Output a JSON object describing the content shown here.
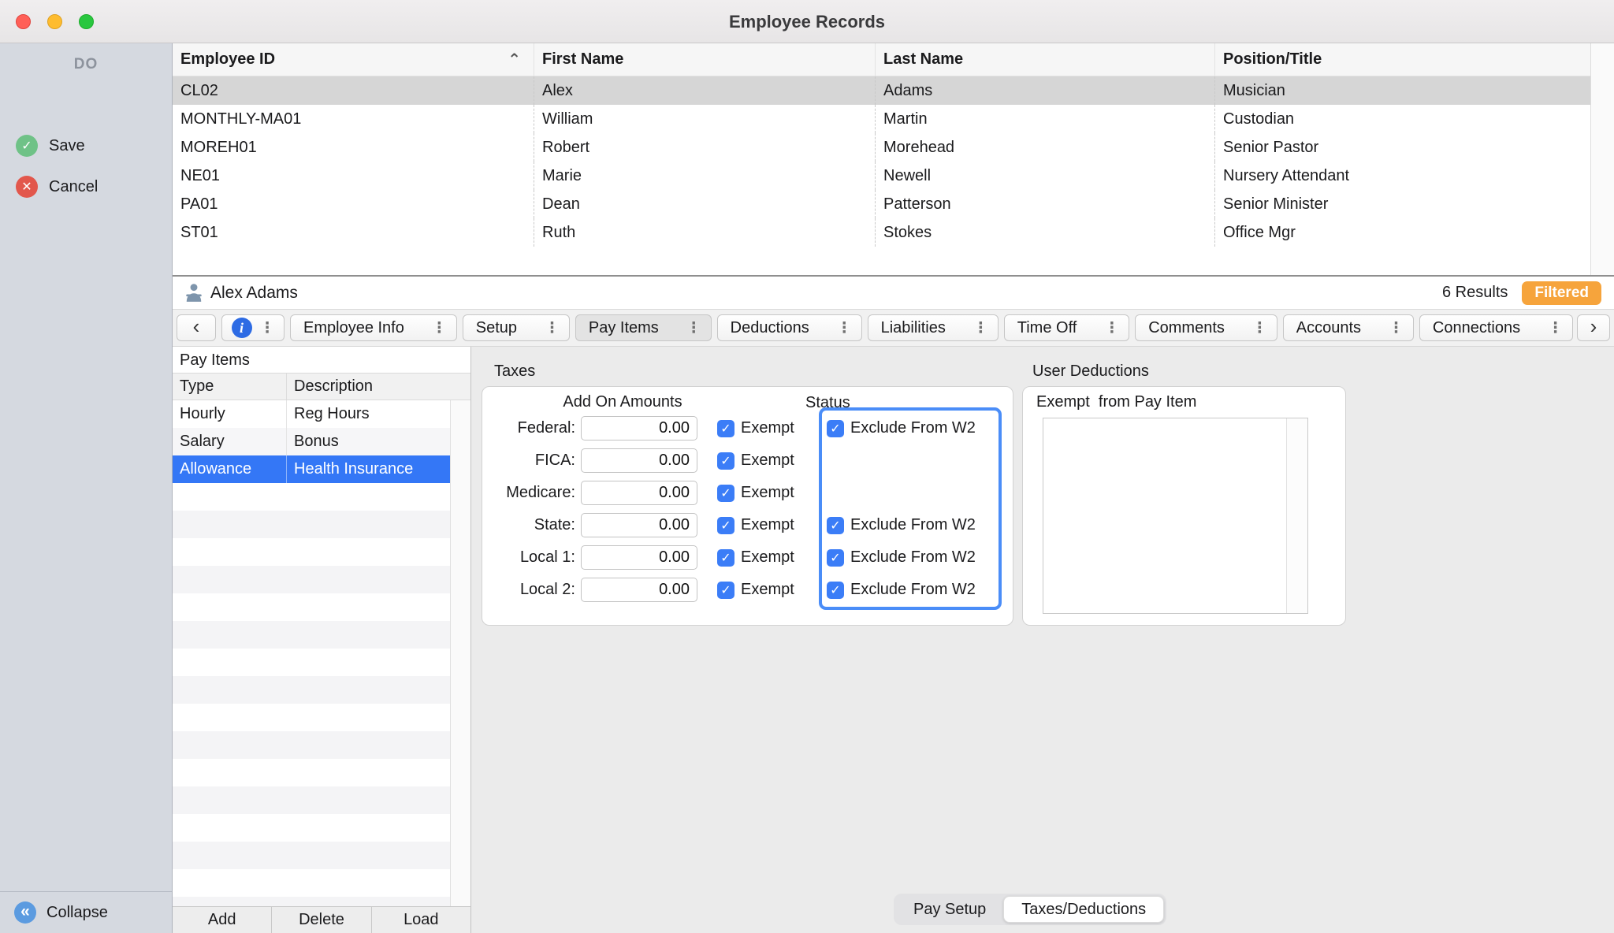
{
  "window": {
    "title": "Employee Records"
  },
  "sidebar": {
    "header": "DO",
    "save_label": "Save",
    "cancel_label": "Cancel",
    "collapse_label": "Collapse"
  },
  "employee_table": {
    "columns": [
      "Employee ID",
      "First Name",
      "Last Name",
      "Position/Title"
    ],
    "sort_column": "Employee ID",
    "sort_direction": "ascending",
    "rows": [
      {
        "id": "CL02",
        "first_name": "Alex",
        "last_name": "Adams",
        "position": "Musician",
        "selected": true
      },
      {
        "id": "MONTHLY-MA01",
        "first_name": "William",
        "last_name": "Martin",
        "position": "Custodian",
        "selected": false
      },
      {
        "id": "MOREH01",
        "first_name": "Robert",
        "last_name": "Morehead",
        "position": "Senior Pastor",
        "selected": false
      },
      {
        "id": "NE01",
        "first_name": "Marie",
        "last_name": "Newell",
        "position": "Nursery Attendant",
        "selected": false
      },
      {
        "id": "PA01",
        "first_name": "Dean",
        "last_name": "Patterson",
        "position": "Senior Minister",
        "selected": false
      },
      {
        "id": "ST01",
        "first_name": "Ruth",
        "last_name": "Stokes",
        "position": "Office Mgr",
        "selected": false
      }
    ]
  },
  "record_bar": {
    "record_name": "Alex Adams",
    "results_count": "6 Results",
    "filter_badge": "Filtered"
  },
  "tab_bar": {
    "tabs": [
      {
        "label": "Employee Info",
        "active": false
      },
      {
        "label": "Setup",
        "active": false
      },
      {
        "label": "Pay Items",
        "active": true
      },
      {
        "label": "Deductions",
        "active": false
      },
      {
        "label": "Liabilities",
        "active": false
      },
      {
        "label": "Time Off",
        "active": false
      },
      {
        "label": "Comments",
        "active": false
      },
      {
        "label": "Accounts",
        "active": false
      },
      {
        "label": "Connections",
        "active": false
      }
    ]
  },
  "pay_items_panel": {
    "title": "Pay Items",
    "columns": [
      "Type",
      "Description"
    ],
    "rows": [
      {
        "type": "Hourly",
        "description": "Reg Hours",
        "selected": false
      },
      {
        "type": "Salary",
        "description": "Bonus",
        "selected": false
      },
      {
        "type": "Allowance",
        "description": "Health Insurance",
        "selected": true
      }
    ],
    "buttons": [
      "Add",
      "Delete",
      "Load"
    ]
  },
  "taxes_panel": {
    "title": "Taxes",
    "amounts_header": "Add On Amounts",
    "status_header": "Status",
    "exempt_label": "Exempt",
    "exclude_label": "Exclude From W2",
    "rows": [
      {
        "label": "Federal:",
        "amount": "0.00",
        "exempt": true,
        "has_exclude": true,
        "exclude_from_w2": true
      },
      {
        "label": "FICA:",
        "amount": "0.00",
        "exempt": true,
        "has_exclude": false
      },
      {
        "label": "Medicare:",
        "amount": "0.00",
        "exempt": true,
        "has_exclude": false
      },
      {
        "label": "State:",
        "amount": "0.00",
        "exempt": true,
        "has_exclude": true,
        "exclude_from_w2": true
      },
      {
        "label": "Local 1:",
        "amount": "0.00",
        "exempt": true,
        "has_exclude": true,
        "exclude_from_w2": true
      },
      {
        "label": "Local 2:",
        "amount": "0.00",
        "exempt": true,
        "has_exclude": true,
        "exclude_from_w2": true
      }
    ]
  },
  "user_deductions_panel": {
    "title": "User Deductions",
    "exempt_from_label": "Exempt  from Pay Item"
  },
  "bottom_tabs": {
    "tabs": [
      {
        "label": "Pay Setup",
        "active": false
      },
      {
        "label": "Taxes/Deductions",
        "active": true
      }
    ]
  },
  "icons": {
    "sort_ascending": "⌃",
    "chevron_left": "‹",
    "chevron_right": "›",
    "overflow_menu": "⋮",
    "info": "i",
    "save_check": "✓",
    "cancel_x": "✕",
    "collapse_chevrons": "«"
  },
  "colors": {
    "accent_blue": "#3477F6",
    "checkbox_blue": "#3B7DF7",
    "focus_ring_blue": "#4A8DF8",
    "filtered_badge_orange": "#F6A43C",
    "save_green": "#6FC287",
    "cancel_red": "#E2574C",
    "collapse_blue": "#5B9BE0",
    "selected_row_gray": "#D6D6D6"
  }
}
